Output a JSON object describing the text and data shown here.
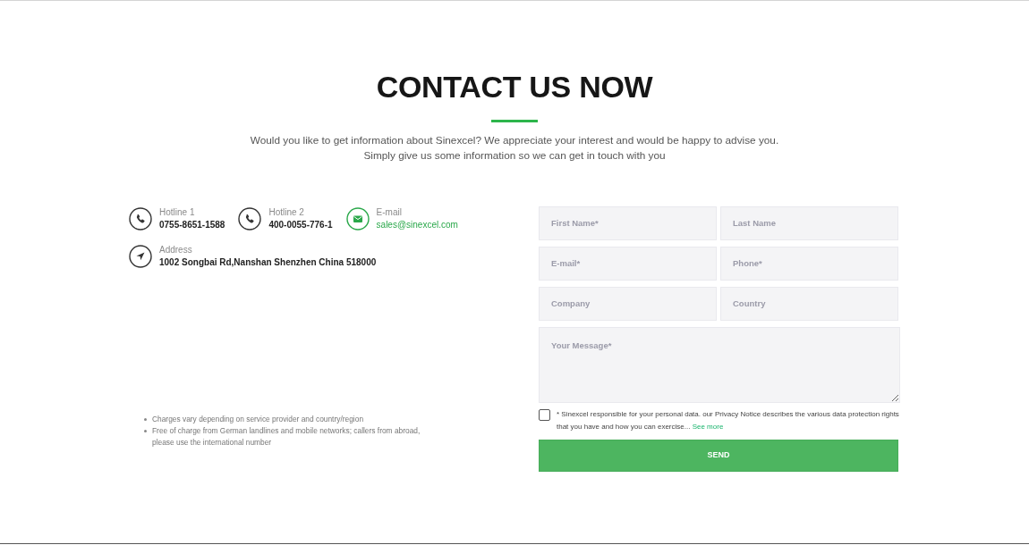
{
  "heading": {
    "title": "CONTACT US NOW",
    "subtitle_lines": [
      "Would you like to get information about Sinexcel? We appreciate your interest and would be happy to advise you.",
      "Simply give us some information so we can get in touch with you"
    ]
  },
  "contacts": [
    {
      "kind": "phone",
      "label": "Hotline 1",
      "value": "0755-8651-1588"
    },
    {
      "kind": "phone",
      "label": "Hotline 2",
      "value": "400-0055-776-1"
    },
    {
      "kind": "email",
      "label": "E-mail",
      "value": "sales@sinexcel.com"
    },
    {
      "kind": "address",
      "label": "Address",
      "value": "1002 Songbai Rd,Nanshan Shenzhen China 518000"
    }
  ],
  "notes": [
    "Charges vary depending on service provider and country/region",
    "Free of charge from German landlines and mobile networks; callers from abroad, please use the international number"
  ],
  "form": {
    "fields": [
      {
        "placeholder": "First Name*"
      },
      {
        "placeholder": "Last Name"
      },
      {
        "placeholder": "E-mail*"
      },
      {
        "placeholder": "Phone*"
      },
      {
        "placeholder": "Company"
      },
      {
        "placeholder": "Country"
      }
    ],
    "message": {
      "placeholder": "Your Message*"
    },
    "consent": {
      "checked": false,
      "text": "* Sinexcel responsible for your personal data. our Privacy Notice describes the various data protection rights that you have and how you can exercise...",
      "link": "See more"
    },
    "submit": "SEND"
  }
}
